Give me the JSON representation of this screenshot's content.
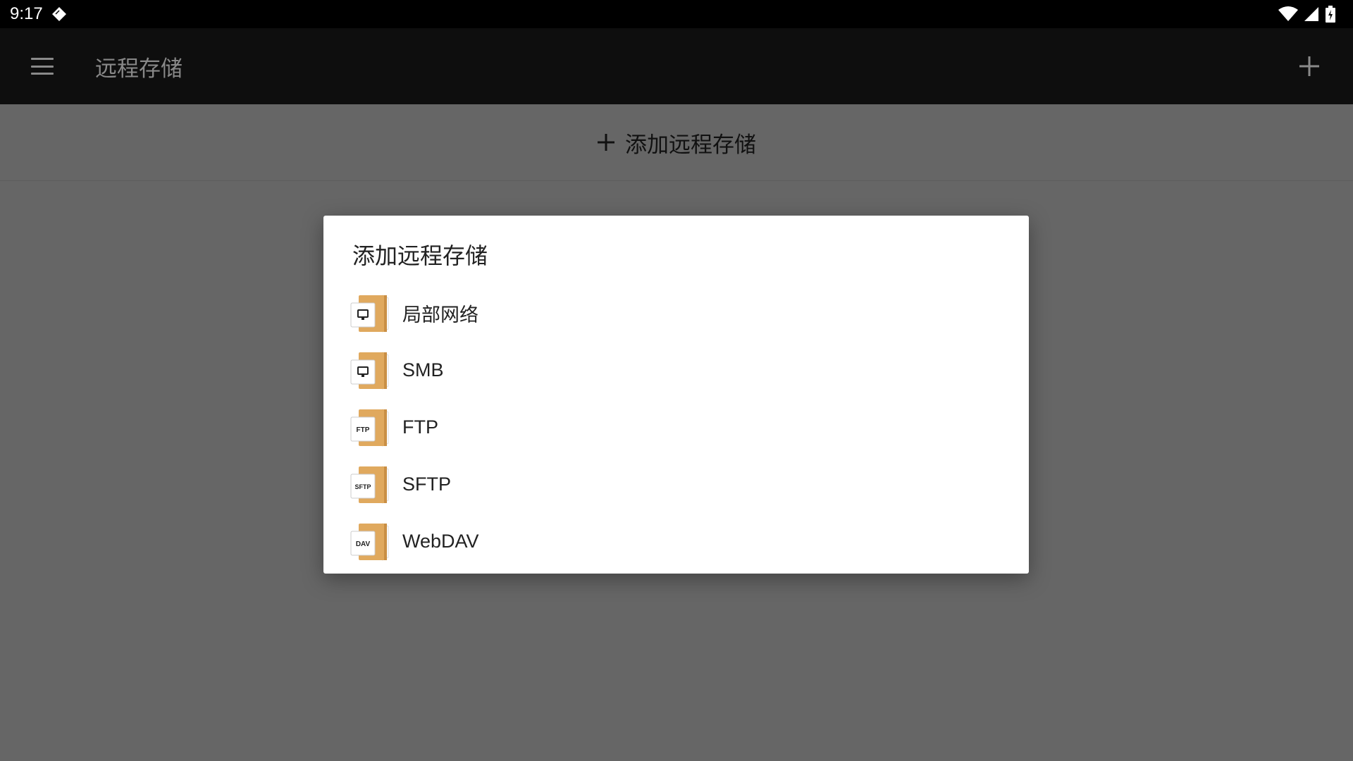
{
  "status_bar": {
    "time": "9:17"
  },
  "app_bar": {
    "title": "远程存储"
  },
  "add_bar": {
    "label": "添加远程存储"
  },
  "dialog": {
    "title": "添加远程存储",
    "options": [
      {
        "label": "局部网络",
        "icon": "monitor-icon",
        "badge": ""
      },
      {
        "label": "SMB",
        "icon": "monitor-icon",
        "badge": ""
      },
      {
        "label": "FTP",
        "icon": "text-badge",
        "badge": "FTP"
      },
      {
        "label": "SFTP",
        "icon": "text-badge",
        "badge": "SFTP"
      },
      {
        "label": "WebDAV",
        "icon": "text-badge",
        "badge": "DAV"
      }
    ]
  },
  "colors": {
    "scrim": "#666666",
    "folder": "#E0A95E",
    "folder_dark": "#C98F45",
    "dialog_bg": "#FFFFFF"
  }
}
